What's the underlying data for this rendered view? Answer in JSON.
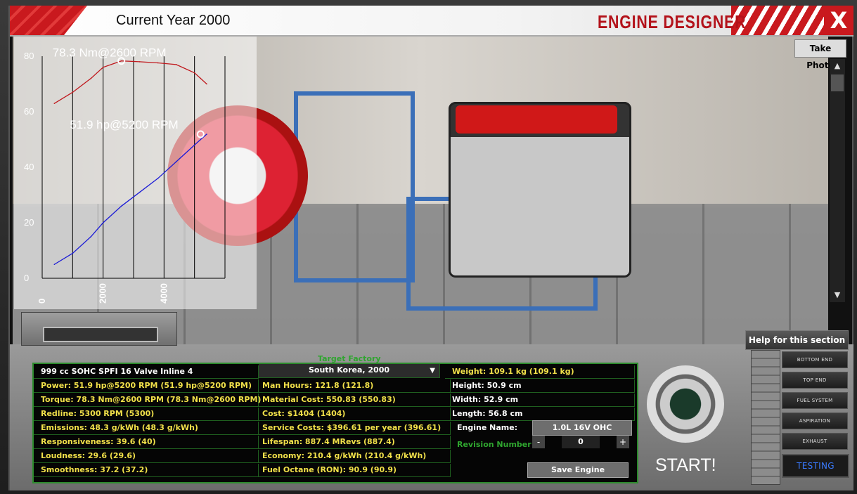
{
  "header": {
    "current_year": "Current Year 2000",
    "title": "ENGINE DESIGNER",
    "close_label": "X"
  },
  "viewport": {
    "take_photo_label": "Take Photo"
  },
  "chart_data": {
    "type": "line",
    "x": [
      400,
      1000,
      1600,
      2000,
      2600,
      3200,
      3800,
      4400,
      5000,
      5200,
      5400
    ],
    "series": [
      {
        "values": [
          63,
          67,
          72,
          76,
          78.3,
          78,
          77.6,
          77,
          74,
          72,
          70
        ]
      },
      {
        "values": [
          5,
          9,
          15,
          20,
          26,
          31,
          36,
          42,
          48,
          50,
          51.9
        ]
      }
    ],
    "ylim": [
      0,
      80
    ],
    "xlim": [
      0,
      6000
    ],
    "y_ticks": [
      "0",
      "20",
      "40",
      "60",
      "80"
    ],
    "x_ticks": [
      "0",
      "2000",
      "4000"
    ],
    "annotations": [
      "78.3 Nm@2600 RPM",
      "51.9 hp@5200 RPM"
    ],
    "colors": {
      "torque": "#c0191e",
      "power": "#1b1bd6"
    }
  },
  "help": {
    "label": "Help for this section"
  },
  "stats": {
    "target_factory_label": "Target Factory",
    "engine_desc": "999 cc SOHC SPFI 16 Valve Inline 4",
    "factory_selected": "South Korea, 2000",
    "col1": [
      "Power: 51.9 hp@5200 RPM (51.9 hp@5200 RPM)",
      "Torque: 78.3 Nm@2600 RPM (78.3 Nm@2600 RPM)",
      "Redline: 5300 RPM (5300)",
      "Emissions: 48.3 g/kWh (48.3 g/kWh)",
      "Responsiveness: 39.6 (40)",
      "Loudness: 29.6 (29.6)",
      "Smoothness: 37.2 (37.2)"
    ],
    "col2": [
      "Man Hours: 121.8 (121.8)",
      "Material Cost: 550.83 (550.83)",
      "Cost: $1404 (1404)",
      "Service Costs: $396.61 per year (396.61)",
      "Lifespan: 887.4 MRevs (887.4)",
      "Economy: 210.4 g/kWh (210.4 g/kWh)",
      "Fuel Octane (RON): 90.9 (90.9)"
    ],
    "col3": [
      "Weight: 109.1 kg (109.1 kg)",
      "Height: 50.9 cm",
      "Width: 52.9 cm",
      "Length: 56.8 cm"
    ],
    "engine_name_label": "Engine Name:",
    "engine_name_value": "1.0L 16V OHC",
    "revision_label": "Revision Number",
    "revision_minus": "-",
    "revision_value": "0",
    "revision_plus": "+",
    "save_label": "Save Engine"
  },
  "start": {
    "label": "START!"
  },
  "sidenav": {
    "items": [
      "BOTTOM END",
      "TOP END",
      "FUEL SYSTEM",
      "ASPIRATION",
      "EXHAUST",
      "TESTING"
    ],
    "active": "TESTING"
  }
}
